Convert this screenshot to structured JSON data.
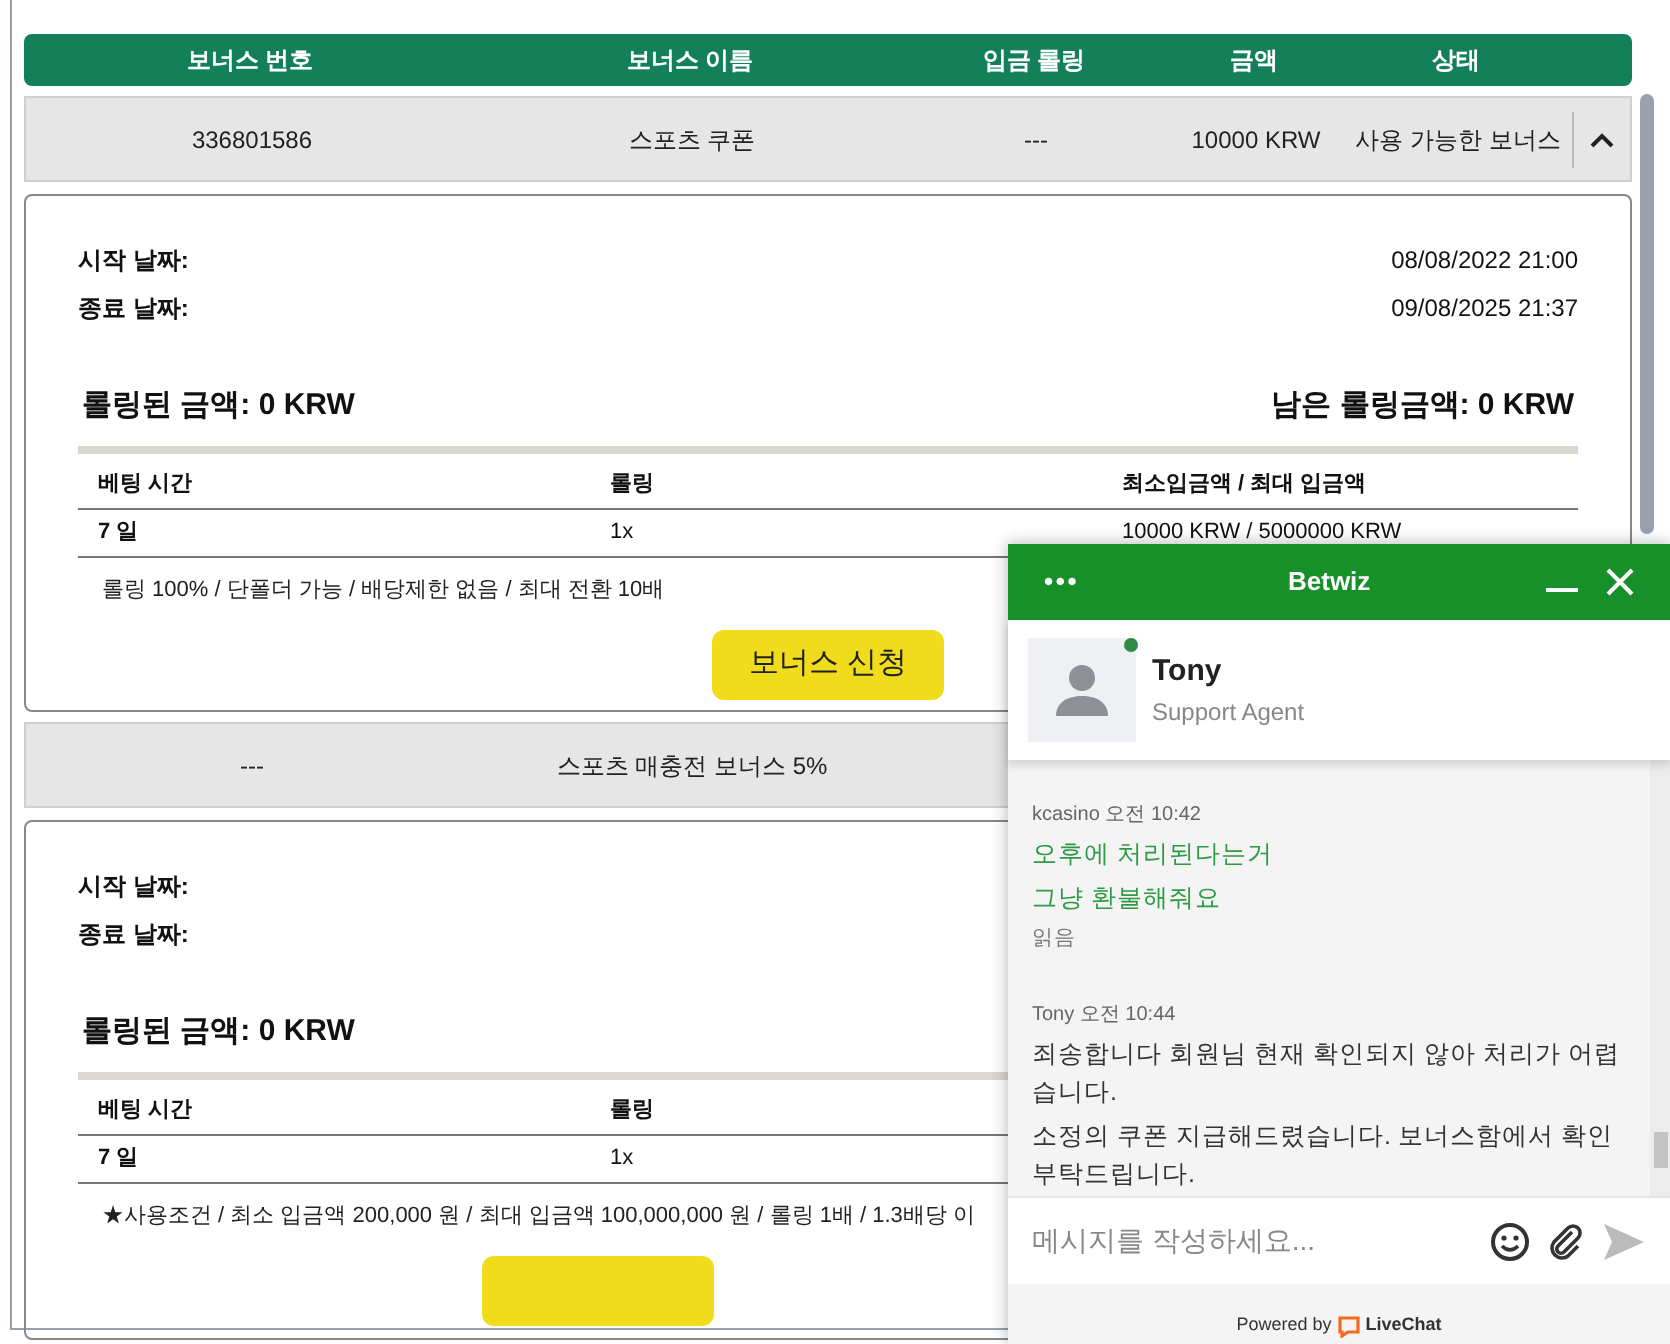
{
  "table": {
    "columns": [
      "보너스 번호",
      "보너스 이름",
      "입금 롤링",
      "금액",
      "상태"
    ],
    "bonuses": [
      {
        "row": {
          "number": "336801586",
          "name": "스포츠 쿠폰",
          "deposit_rolling": "---",
          "amount": "10000 KRW",
          "status": "사용 가능한 보너스"
        },
        "expanded": true,
        "detail": {
          "start_label": "시작 날짜:",
          "start_value": "08/08/2022 21:00",
          "end_label": "종료 날짜:",
          "end_value": "09/08/2025 21:37",
          "rolled": "롤링된 금액: 0 KRW",
          "remaining": "남은 롤링금액: 0 KRW",
          "columns": [
            "베팅 시간",
            "롤링",
            "최소입금액 / 최대 입금액"
          ],
          "cells": [
            "7 일",
            "1x",
            "10000 KRW / 5000000 KRW"
          ],
          "conditions": "롤링 100% / 단폴더 가능 / 배당제한 없음 / 최대 전환 10배",
          "apply_label": "보너스 신청"
        }
      },
      {
        "row": {
          "number": "---",
          "name": "스포츠 매충전 보너스 5%"
        },
        "expanded": true,
        "detail": {
          "start_label": "시작 날짜:",
          "end_label": "종료 날짜:",
          "rolled": "롤링된 금액: 0 KRW",
          "columns": [
            "베팅 시간",
            "롤링"
          ],
          "cells": [
            "7 일",
            "1x"
          ],
          "conditions": "★사용조건 / 최소 입금액 200,000 원 / 최대 입금액 100,000,000 원 / 롤링 1배 / 1.3배당 이"
        }
      }
    ]
  },
  "chat": {
    "menu": "•••",
    "title": "Betwiz",
    "agent": {
      "name": "Tony",
      "role": "Support Agent",
      "online": true
    },
    "messages": [
      {
        "kind": "customer",
        "author": "kcasino",
        "time": "오전 10:42",
        "lines": [
          "오후에 처리된다는거",
          "그냥 환불해줘요"
        ],
        "receipt": "읽음"
      },
      {
        "kind": "agent",
        "author": "Tony",
        "time": "오전 10:44",
        "lines": [
          "죄송합니다 회원님 현재 확인되지 않아 처리가 어렵습니다.",
          "소정의 쿠폰 지급해드렸습니다. 보너스함에서 확인 부탁드립니다."
        ]
      }
    ],
    "input": {
      "placeholder": "메시지를 작성하세요..."
    },
    "footer": {
      "prefix": "Powered by",
      "brand": "LiveChat"
    }
  }
}
